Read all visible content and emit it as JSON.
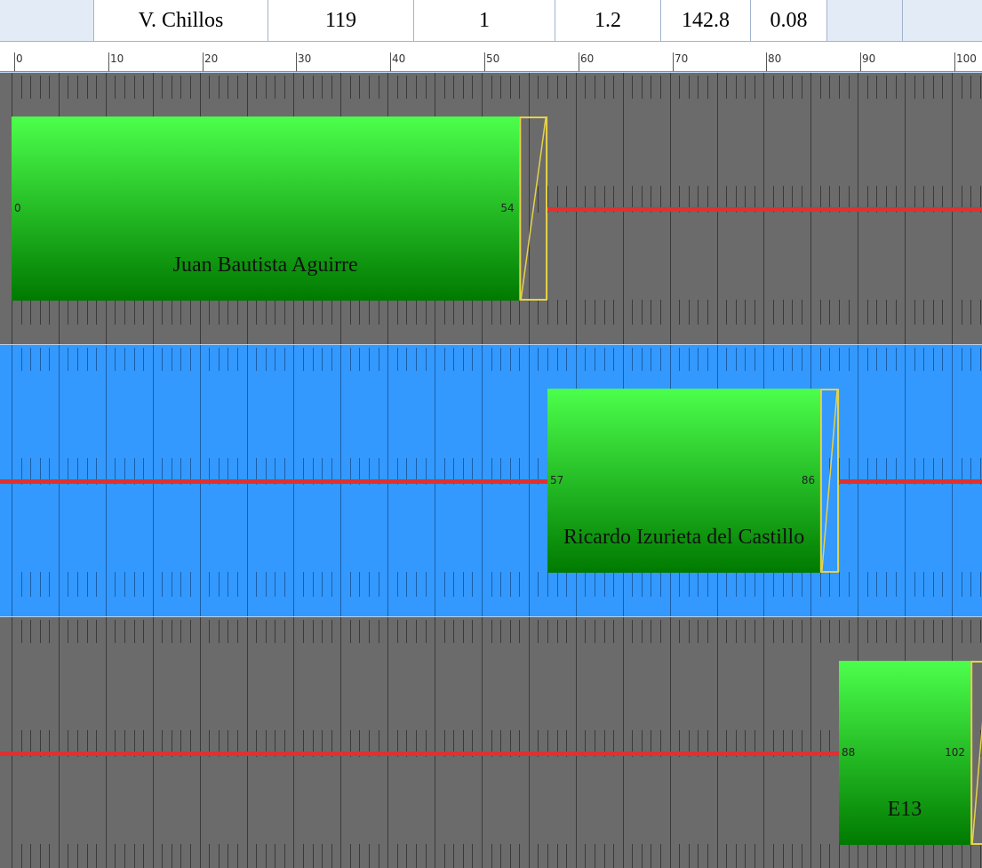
{
  "table": {
    "cells": [
      "",
      "V. Chillos",
      "119",
      "1",
      "1.2",
      "142.8",
      "0.08",
      "",
      ""
    ]
  },
  "ruler": {
    "labels": [
      "0",
      "10",
      "20",
      "30",
      "40",
      "50",
      "60",
      "70",
      "80",
      "90",
      "100"
    ]
  },
  "lanes": [
    {
      "selected": false,
      "block": {
        "label": "Juan Bautista Aguirre",
        "start": 0,
        "end": 54,
        "start_label": "0",
        "end_label": "54",
        "changeover_end": 57
      },
      "line_before": false,
      "line_after": true
    },
    {
      "selected": true,
      "block": {
        "label": "Ricardo Izurieta del Castillo",
        "start": 57,
        "end": 86,
        "start_label": "57",
        "end_label": "86",
        "changeover_end": 88
      },
      "line_before": true,
      "line_after": true
    },
    {
      "selected": false,
      "block": {
        "label": "E13",
        "start": 88,
        "end": 102,
        "start_label": "88",
        "end_label": "102",
        "changeover_end": 104
      },
      "line_before": true,
      "line_after": false
    }
  ],
  "colors": {
    "lane_bg": "#6b6b6b",
    "lane_selected_bg": "#3399ff",
    "block_top": "#4cff4c",
    "block_bottom": "#007a00",
    "changeover": "#e6d24a",
    "connector": "#e03030",
    "tick": "#3a3a3a",
    "tick_selected": "#1a5fa8"
  }
}
